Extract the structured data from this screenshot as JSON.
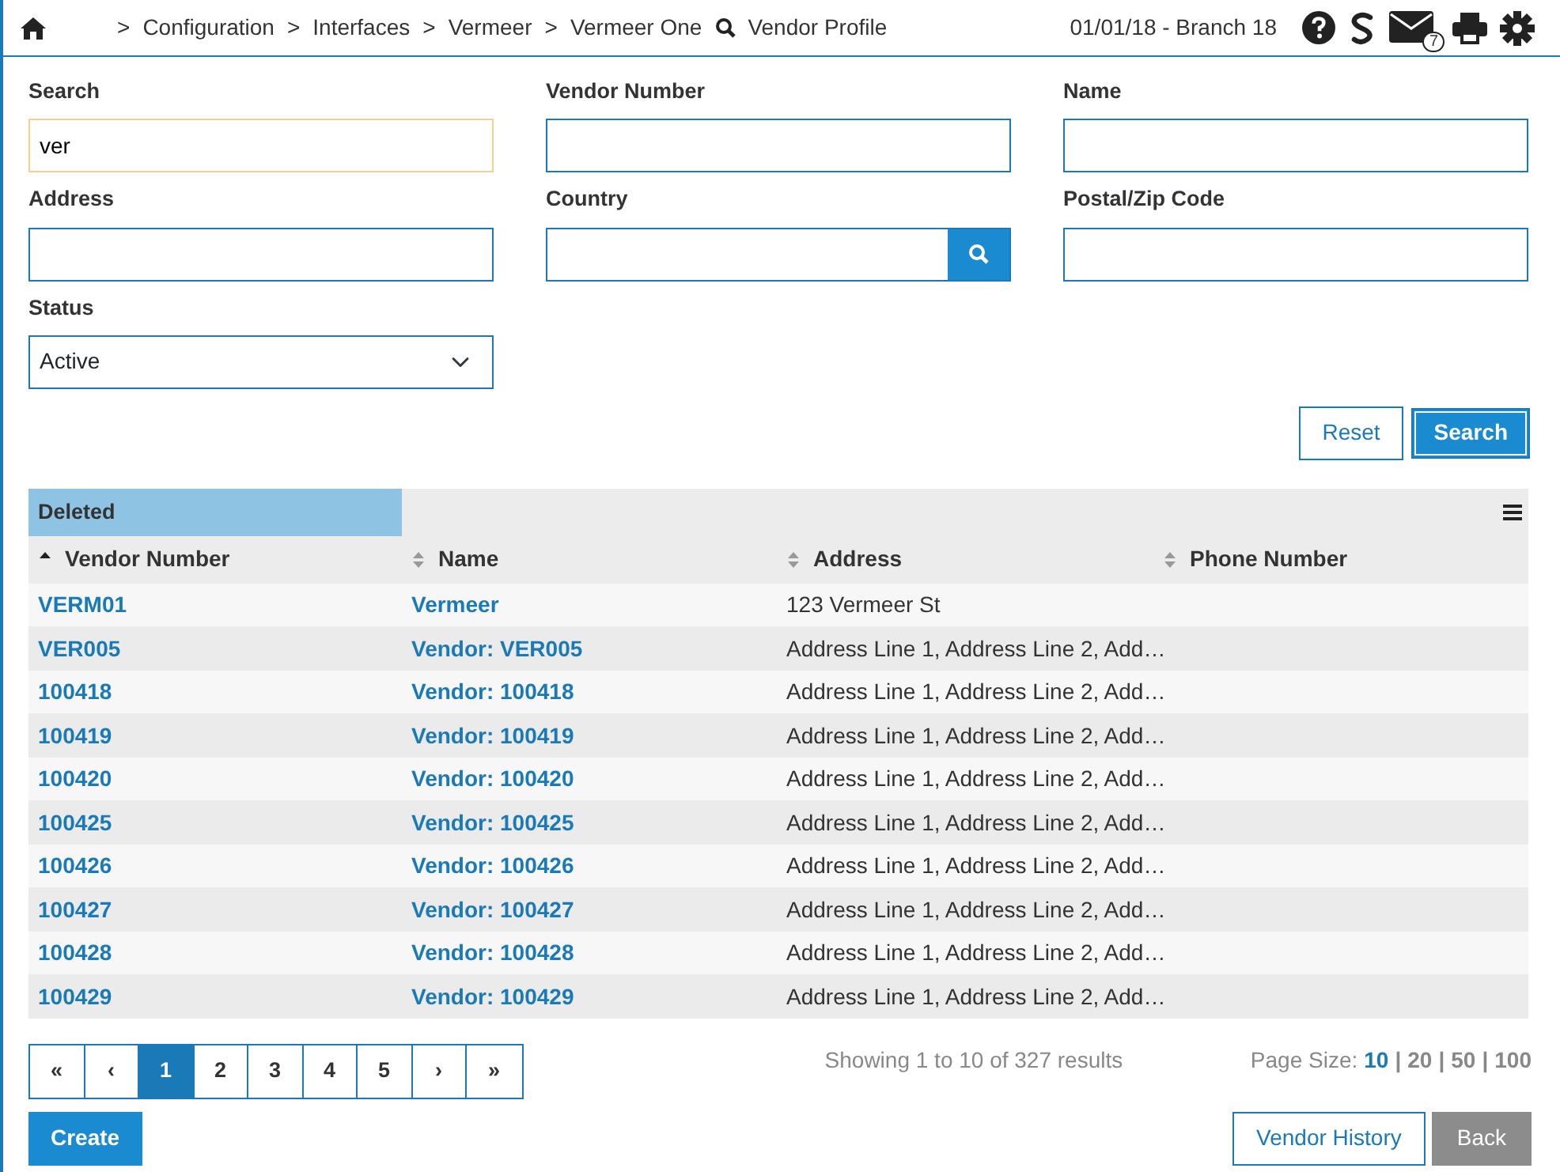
{
  "header": {
    "crumbs": [
      {
        "kind": "link",
        "sep": ">",
        "label": "Configuration"
      },
      {
        "kind": "link",
        "sep": ">",
        "label": "Interfaces"
      },
      {
        "kind": "link",
        "sep": ">",
        "label": "Vermeer"
      },
      {
        "kind": "link",
        "sep": ">",
        "label": "Vermeer One"
      },
      {
        "kind": "search",
        "label": "Vendor Profile"
      }
    ],
    "branch": "01/01/18 - Branch 18",
    "mail_count": "7"
  },
  "filters": [
    {
      "kind": "text",
      "label": "Search",
      "value": "ver",
      "focused": true
    },
    {
      "kind": "text",
      "label": "Vendor Number",
      "focused": false
    },
    {
      "kind": "text",
      "label": "Name",
      "focused": false
    },
    {
      "kind": "text",
      "label": "Address",
      "focused": false
    },
    {
      "kind": "lookup",
      "label": "Country",
      "focused": false
    },
    {
      "kind": "text",
      "label": "Postal/Zip Code",
      "focused": false
    },
    {
      "kind": "select",
      "label": "Status",
      "value": "Active",
      "focused": false
    }
  ],
  "form_buttons": [
    {
      "label": "Reset",
      "primary": false
    },
    {
      "label": "Search",
      "primary": true
    }
  ],
  "table": {
    "group_label": "Deleted",
    "columns": [
      {
        "label": "Vendor Number",
        "sorted": true
      },
      {
        "label": "Name",
        "sorted": false
      },
      {
        "label": "Address",
        "sorted": false
      },
      {
        "label": "Phone Number",
        "sorted": false
      }
    ],
    "rows": [
      [
        "VERM01",
        "Vermeer",
        "123 Vermeer St"
      ],
      [
        "VER005",
        "Vendor: VER005",
        "Address Line 1, Address Line 2, Add…"
      ],
      [
        "100418",
        "Vendor: 100418",
        "Address Line 1, Address Line 2, Add…"
      ],
      [
        "100419",
        "Vendor: 100419",
        "Address Line 1, Address Line 2, Add…"
      ],
      [
        "100420",
        "Vendor: 100420",
        "Address Line 1, Address Line 2, Add…"
      ],
      [
        "100425",
        "Vendor: 100425",
        "Address Line 1, Address Line 2, Add…"
      ],
      [
        "100426",
        "Vendor: 100426",
        "Address Line 1, Address Line 2, Add…"
      ],
      [
        "100427",
        "Vendor: 100427",
        "Address Line 1, Address Line 2, Add…"
      ],
      [
        "100428",
        "Vendor: 100428",
        "Address Line 1, Address Line 2, Add…"
      ],
      [
        "100429",
        "Vendor: 100429",
        "Address Line 1, Address Line 2, Add…"
      ]
    ]
  },
  "pagination": [
    {
      "label": "«",
      "selected": false
    },
    {
      "label": "‹",
      "selected": false
    },
    {
      "label": "1",
      "selected": true
    },
    {
      "label": "2",
      "selected": false
    },
    {
      "label": "3",
      "selected": false
    },
    {
      "label": "4",
      "selected": false
    },
    {
      "label": "5",
      "selected": false
    },
    {
      "label": "›",
      "selected": false
    },
    {
      "label": "»",
      "selected": false
    }
  ],
  "results_text": "Showing 1 to 10 of 327 results",
  "page_size": {
    "label": "Page Size:",
    "separator": "|",
    "options": [
      {
        "label": "10",
        "selected": true
      },
      {
        "label": "20",
        "selected": false
      },
      {
        "label": "50",
        "selected": false
      },
      {
        "label": "100",
        "selected": false
      }
    ]
  },
  "footer_buttons": [
    {
      "label": "Create",
      "kind": "primary"
    },
    {
      "label": "Vendor History",
      "kind": "outline"
    },
    {
      "label": "Back",
      "kind": "grey"
    }
  ]
}
